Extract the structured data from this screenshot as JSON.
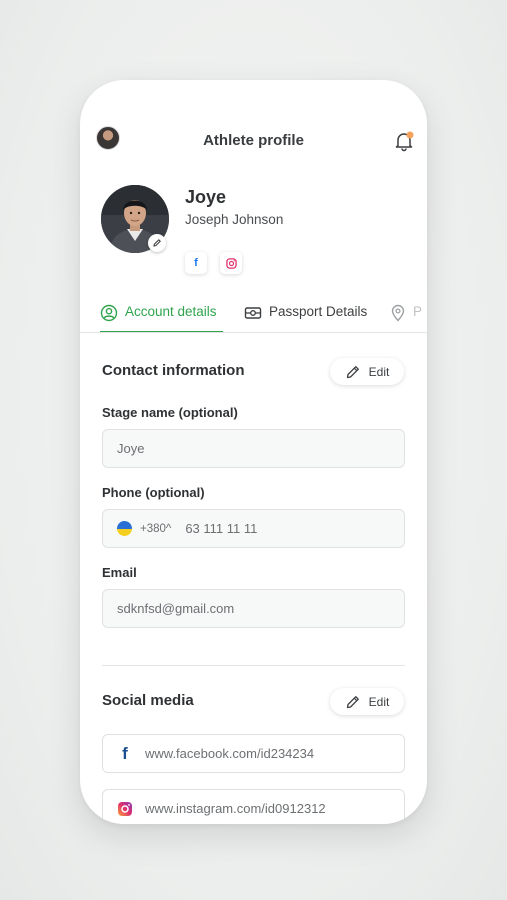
{
  "header": {
    "title": "Athlete profile"
  },
  "profile": {
    "name": "Joye",
    "full_name": "Joseph Johnson",
    "social_links": [
      {
        "icon": "facebook-icon",
        "glyph": "f",
        "color": "#1877f2"
      },
      {
        "icon": "instagram-icon",
        "color": "#e1306c"
      }
    ]
  },
  "tabs": [
    {
      "label": "Account details",
      "icon": "user-circle-icon",
      "active": true
    },
    {
      "label": "Passport Details",
      "icon": "id-card-icon",
      "active": false
    },
    {
      "label": "P",
      "icon": "location-pin-icon",
      "active": false
    }
  ],
  "contact": {
    "title": "Contact information",
    "edit_label": "Edit",
    "stage_name": {
      "label": "Stage name (optional)",
      "value": "Joye"
    },
    "phone": {
      "label": "Phone (optional)",
      "country_code": "+380",
      "chevron": "^",
      "value": "63 111 11 11"
    },
    "email": {
      "label": "Email",
      "value": "sdknfsd@gmail.com"
    }
  },
  "social": {
    "title": "Social media",
    "edit_label": "Edit",
    "facebook": {
      "glyph": "f",
      "value": "www.facebook.com/id234234"
    },
    "instagram": {
      "value": "www.instagram.com/id0912312"
    }
  },
  "colors": {
    "accent": "#2fa44d",
    "notification_dot": "#f5a25d",
    "facebook": "#1877f2",
    "instagram": "#e1306c"
  }
}
